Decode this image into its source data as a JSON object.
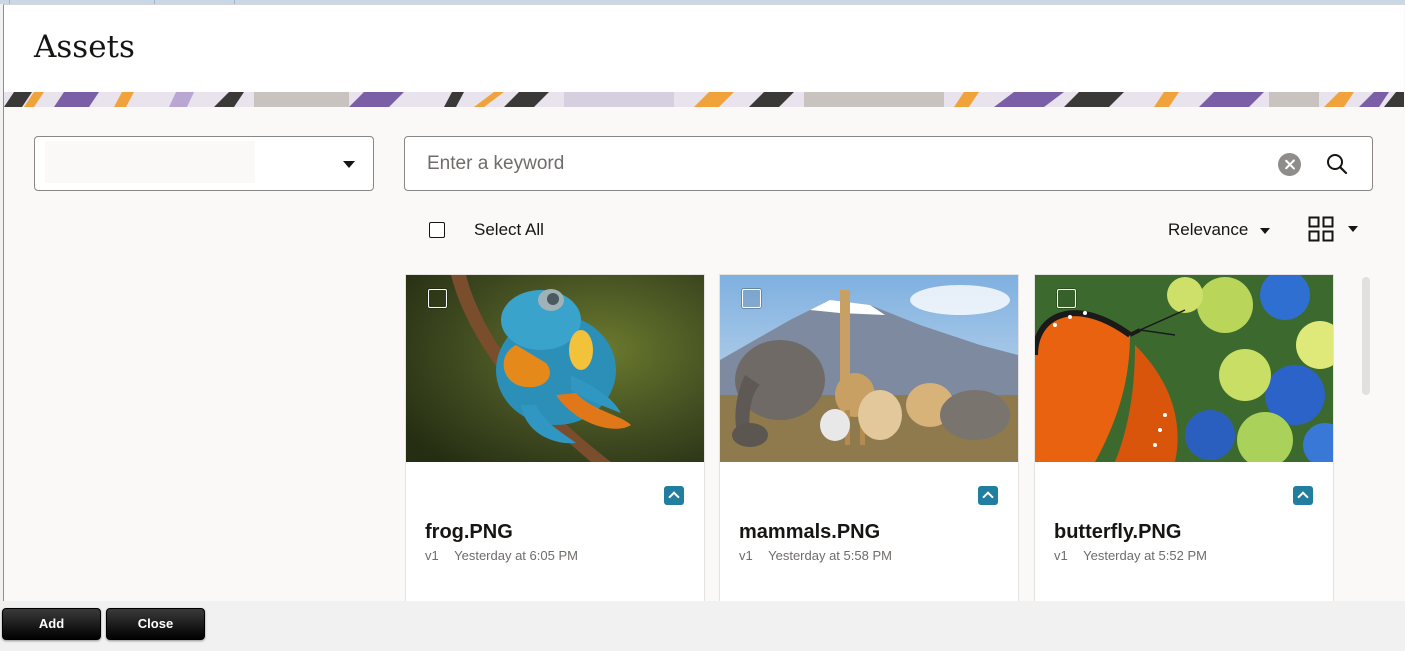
{
  "dialog": {
    "title": "Assets"
  },
  "folder_select": {
    "value": ""
  },
  "search": {
    "placeholder": "Enter a keyword",
    "value": ""
  },
  "toolbar": {
    "select_all_label": "Select All",
    "sort_label": "Relevance"
  },
  "assets": [
    {
      "name": "frog.PNG",
      "version": "v1",
      "modified": "Yesterday at 6:05 PM"
    },
    {
      "name": "mammals.PNG",
      "version": "v1",
      "modified": "Yesterday at 5:58 PM"
    },
    {
      "name": "butterfly.PNG",
      "version": "v1",
      "modified": "Yesterday at 5:52 PM"
    }
  ],
  "footer": {
    "add_label": "Add",
    "close_label": "Close"
  },
  "colors": {
    "accent": "#227e9e",
    "button": "#1a1a1a",
    "banner_purple": "#7a5ea6",
    "banner_orange": "#f0a33a"
  }
}
